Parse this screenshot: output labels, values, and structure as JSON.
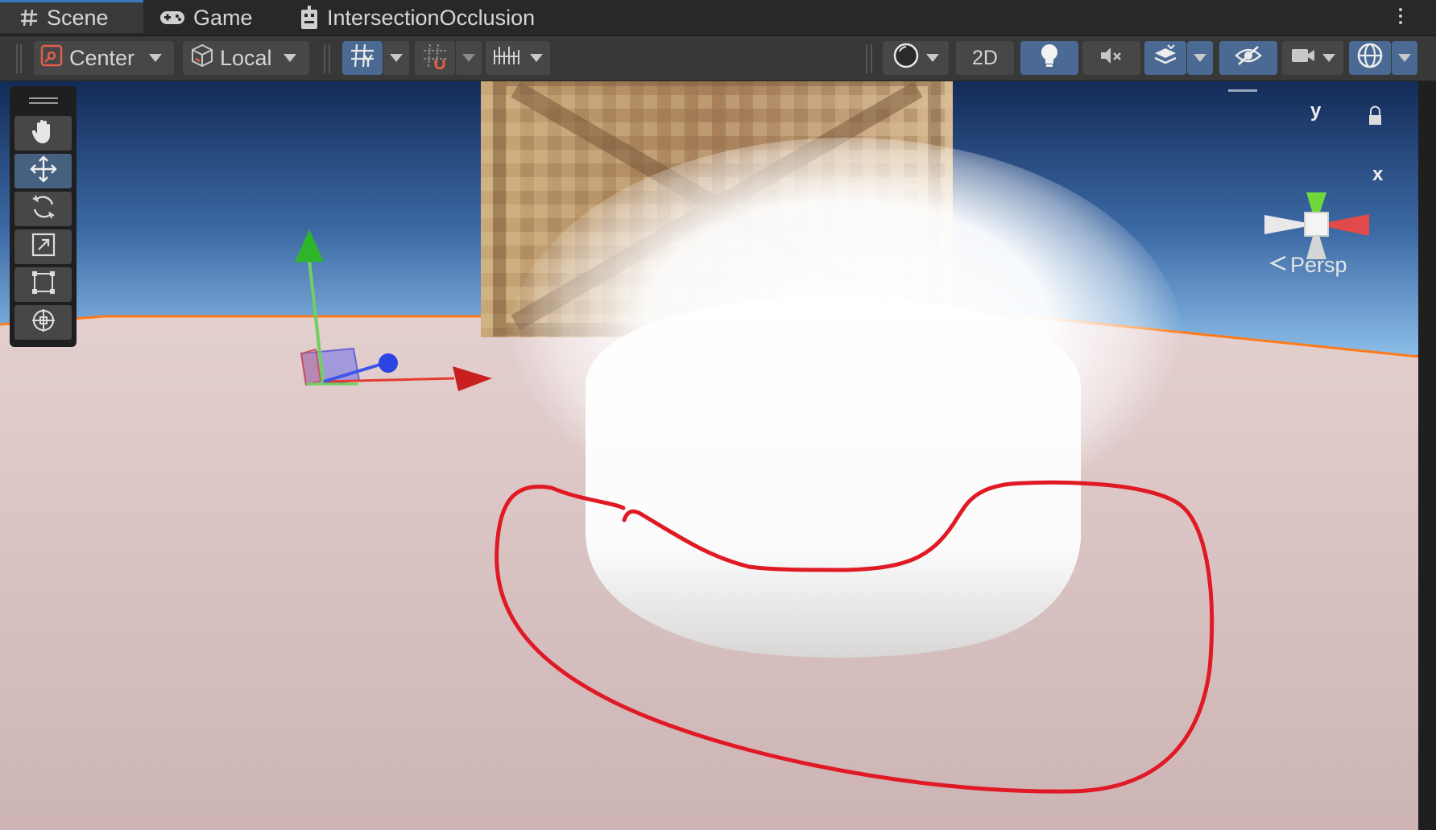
{
  "tabs": [
    {
      "label": "Scene",
      "icon": "grid-hash-icon",
      "active": true
    },
    {
      "label": "Game",
      "icon": "gamepad-icon",
      "active": false
    },
    {
      "label": "IntersectionOcclusion",
      "icon": "robot-icon",
      "active": false
    }
  ],
  "toolbar": {
    "pivot_label": "Center",
    "space_label": "Local",
    "mode_2d_label": "2D"
  },
  "gizmo": {
    "projection_label": "Persp",
    "axis_y": "y",
    "axis_x": "x"
  },
  "colors": {
    "sky_top": "#16305e",
    "sky_horizon": "#7fb0e0",
    "ground": "#d5bcbc",
    "selection_outline": "#ff7a18",
    "annotation_red": "#e01a25",
    "toolbar_active": "#4a6a93"
  }
}
